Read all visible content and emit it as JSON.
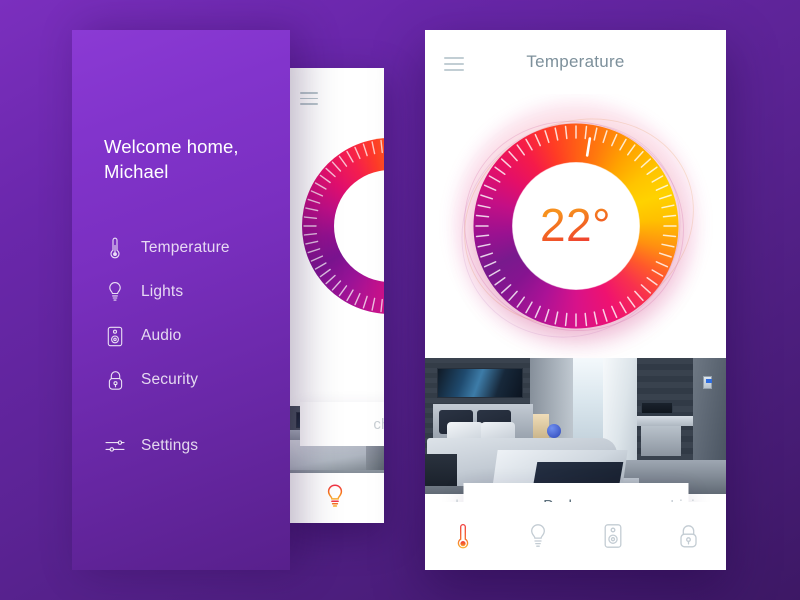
{
  "app": {
    "background_gradient_from": "#7b2fbe",
    "background_gradient_to": "#3d1865"
  },
  "sidebar": {
    "panel_color": "#8b3ad4",
    "greeting_line1": "Welcome home,",
    "greeting_line2": "Michael",
    "items": [
      {
        "label": "Temperature",
        "icon": "thermometer-icon"
      },
      {
        "label": "Lights",
        "icon": "bulb-icon"
      },
      {
        "label": "Audio",
        "icon": "speaker-icon"
      },
      {
        "label": "Security",
        "icon": "lock-icon"
      },
      {
        "label": "Settings",
        "icon": "sliders-icon"
      }
    ]
  },
  "middle_phone": {
    "menu_icon": "hamburger-icon",
    "room_label": "chen",
    "bottom_active_icon": "bulb-icon"
  },
  "main_phone": {
    "menu_icon": "hamburger-icon",
    "title": "Temperature",
    "dial": {
      "value": "22°",
      "value_color_start": "#f58220",
      "value_color_end": "#ec2f3d",
      "ring_accent": "#ff5d16",
      "tick_count": 60,
      "indicator_position_deg": 9
    },
    "room_tabs": [
      {
        "label": "chen",
        "active": false
      },
      {
        "label": "Bedroom",
        "active": true
      },
      {
        "label": "Livin",
        "active": false
      }
    ],
    "bottom_nav": [
      {
        "icon": "thermometer-icon",
        "label": "Temperature",
        "active": true
      },
      {
        "icon": "bulb-icon",
        "label": "Lights",
        "active": false
      },
      {
        "icon": "speaker-icon",
        "label": "Audio",
        "active": false
      },
      {
        "icon": "lock-icon",
        "label": "Security",
        "active": false
      }
    ],
    "active_accent": "#f05a28",
    "inactive_color": "#c3ccd3"
  }
}
